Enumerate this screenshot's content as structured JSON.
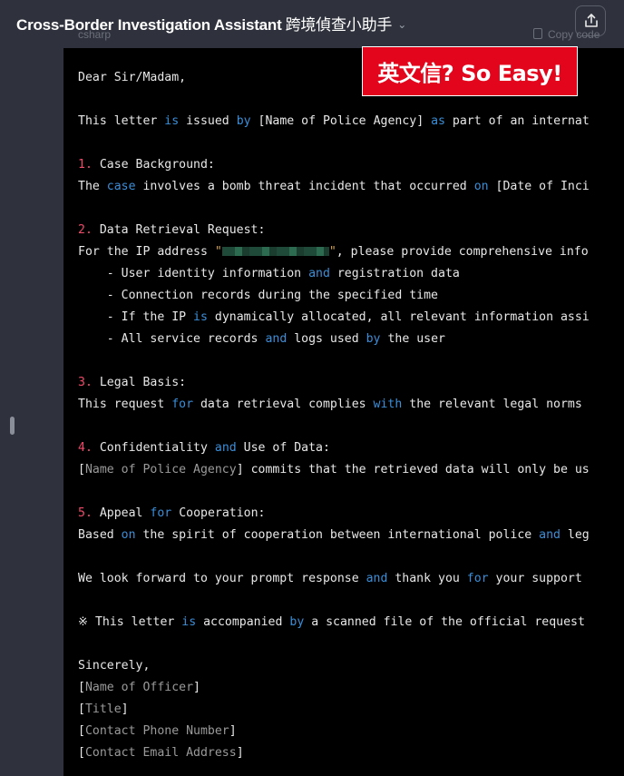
{
  "header": {
    "app_title": "Cross-Border Investigation Assistant",
    "app_title_cjk": "跨境偵查小助手",
    "chevron_icon": "chevron-down-icon",
    "share_icon": "share-icon"
  },
  "code_block": {
    "language": "csharp",
    "copy_label": "Copy code"
  },
  "banner": {
    "text": "英文信? So Easy!"
  },
  "letter": [
    [
      {
        "t": "Dear Sir/Madam,"
      }
    ],
    [],
    [
      {
        "t": "This letter "
      },
      {
        "t": "is",
        "c": "kw"
      },
      {
        "t": " issued "
      },
      {
        "t": "by",
        "c": "kw"
      },
      {
        "t": " [Name of Police Agency] "
      },
      {
        "t": "as",
        "c": "kw"
      },
      {
        "t": " part of an internat"
      }
    ],
    [],
    [
      {
        "t": "1.",
        "c": "num"
      },
      {
        "t": " Case Background:"
      }
    ],
    [
      {
        "t": "The "
      },
      {
        "t": "case",
        "c": "kw"
      },
      {
        "t": " involves a bomb threat incident that occurred "
      },
      {
        "t": "on",
        "c": "kw"
      },
      {
        "t": " [Date of Inci"
      }
    ],
    [],
    [
      {
        "t": "2.",
        "c": "num"
      },
      {
        "t": " Data Retrieval Request:"
      }
    ],
    [
      {
        "t": "For the IP address "
      },
      {
        "t": "\"",
        "c": "str"
      },
      {
        "redact": true
      },
      {
        "t": "\"",
        "c": "str"
      },
      {
        "t": ", please provide comprehensive info"
      }
    ],
    [
      {
        "t": "    - User identity information "
      },
      {
        "t": "and",
        "c": "kw"
      },
      {
        "t": " registration data"
      }
    ],
    [
      {
        "t": "    - Connection records during the specified time"
      }
    ],
    [
      {
        "t": "    - If the IP "
      },
      {
        "t": "is",
        "c": "kw"
      },
      {
        "t": " dynamically allocated, all relevant information assi"
      }
    ],
    [
      {
        "t": "    - All service records "
      },
      {
        "t": "and",
        "c": "kw"
      },
      {
        "t": " logs used "
      },
      {
        "t": "by",
        "c": "kw"
      },
      {
        "t": " the user"
      }
    ],
    [],
    [
      {
        "t": "3.",
        "c": "num"
      },
      {
        "t": " Legal Basis:"
      }
    ],
    [
      {
        "t": "This request "
      },
      {
        "t": "for",
        "c": "kw"
      },
      {
        "t": " data retrieval complies "
      },
      {
        "t": "with",
        "c": "kw"
      },
      {
        "t": " the relevant legal norms "
      }
    ],
    [],
    [
      {
        "t": "4.",
        "c": "num"
      },
      {
        "t": " Confidentiality "
      },
      {
        "t": "and",
        "c": "kw"
      },
      {
        "t": " Use of Data:"
      }
    ],
    [
      {
        "t": "["
      },
      {
        "t": "Name of Police Agency",
        "c": "ph"
      },
      {
        "t": "] commits that the retrieved data will only be us"
      }
    ],
    [],
    [
      {
        "t": "5.",
        "c": "num"
      },
      {
        "t": " Appeal "
      },
      {
        "t": "for",
        "c": "kw"
      },
      {
        "t": " Cooperation:"
      }
    ],
    [
      {
        "t": "Based "
      },
      {
        "t": "on",
        "c": "kw"
      },
      {
        "t": " the spirit of cooperation between international police "
      },
      {
        "t": "and",
        "c": "kw"
      },
      {
        "t": " leg"
      }
    ],
    [],
    [
      {
        "t": "We look forward to your prompt response "
      },
      {
        "t": "and",
        "c": "kw"
      },
      {
        "t": " thank you "
      },
      {
        "t": "for",
        "c": "kw"
      },
      {
        "t": " your support "
      }
    ],
    [],
    [
      {
        "t": "※ This letter "
      },
      {
        "t": "is",
        "c": "kw"
      },
      {
        "t": " accompanied "
      },
      {
        "t": "by",
        "c": "kw"
      },
      {
        "t": " a scanned file of the official request "
      }
    ],
    [],
    [
      {
        "t": "Sincerely,"
      }
    ],
    [
      {
        "t": "["
      },
      {
        "t": "Name of Officer",
        "c": "ph"
      },
      {
        "t": "]"
      }
    ],
    [
      {
        "t": "["
      },
      {
        "t": "Title",
        "c": "ph"
      },
      {
        "t": "]"
      }
    ],
    [
      {
        "t": "["
      },
      {
        "t": "Contact Phone Number",
        "c": "ph"
      },
      {
        "t": "]"
      }
    ],
    [
      {
        "t": "["
      },
      {
        "t": "Contact Email Address",
        "c": "ph"
      },
      {
        "t": "]"
      }
    ]
  ]
}
